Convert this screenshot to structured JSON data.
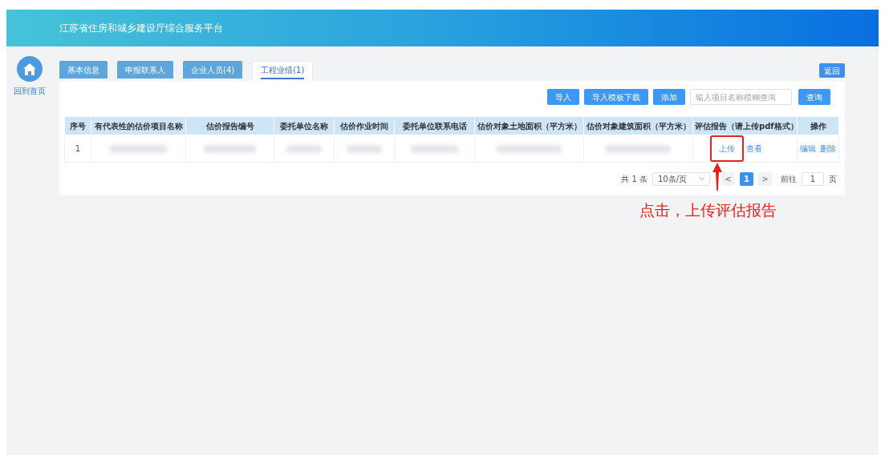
{
  "header": {
    "title": "江苏省住房和城乡建设厅综合服务平台"
  },
  "sidebar": {
    "home_label": "回到首页"
  },
  "tabs": [
    {
      "label": "基本信息",
      "selected": false
    },
    {
      "label": "申报联系人",
      "selected": false
    },
    {
      "label": "企业人员(4)",
      "selected": false
    },
    {
      "label": "工程业绩(1)",
      "selected": true
    }
  ],
  "back_button": "返回",
  "toolbar": {
    "buttons": [
      "导入",
      "导入模板下载",
      "添加"
    ],
    "search": {
      "placeholder": "输入项目名称模糊查询"
    },
    "query_button": "查询"
  },
  "table": {
    "columns": [
      "序号",
      "有代表性的估价项目名称",
      "估价报告编号",
      "委托单位名称",
      "估价作业时间",
      "委托单位联系电话",
      "估价对象土地面积（平方米）",
      "估价对象建筑面积（平方米）",
      "评估报告（请上传pdf格式）",
      "操作"
    ],
    "rows": [
      {
        "index": "1",
        "report_links": [
          "上传",
          "查看"
        ],
        "actions": [
          "编辑",
          "删除"
        ]
      }
    ]
  },
  "pagination": {
    "total": "共 1 条",
    "page_size": "10条/页",
    "prev": "<",
    "pages": [
      {
        "label": "1",
        "selected": true
      }
    ],
    "next": ">",
    "goto_label": "前往",
    "goto_value": "1",
    "goto_suffix": "页"
  },
  "annotation": {
    "text": "点击，上传评估报告"
  }
}
